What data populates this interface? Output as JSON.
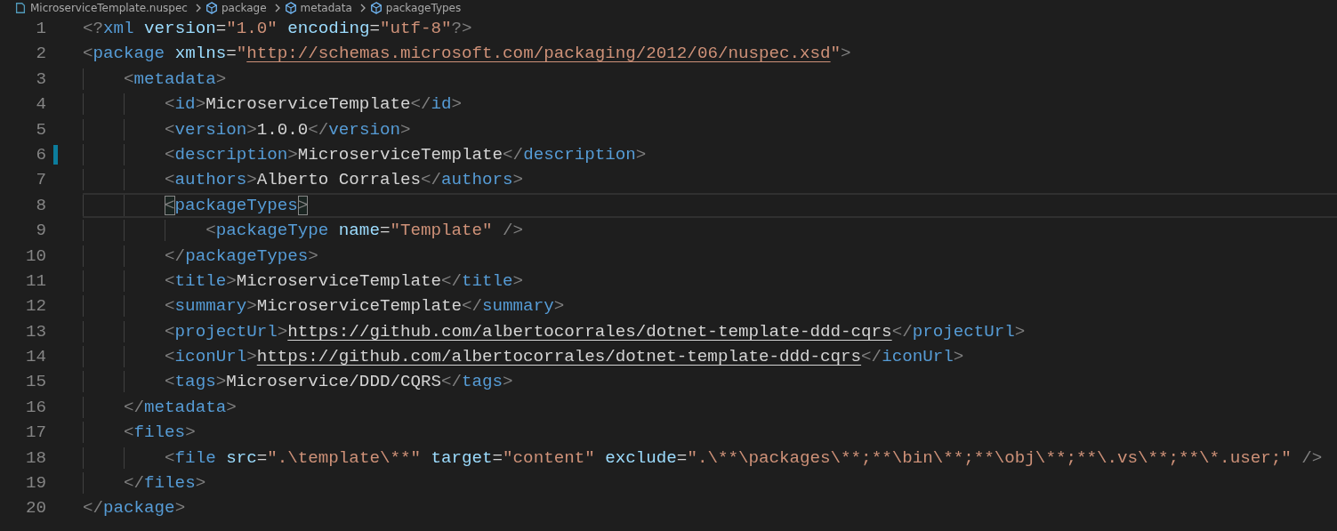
{
  "breadcrumb": [
    {
      "kind": "file",
      "label": "MicroserviceTemplate.nuspec"
    },
    {
      "kind": "symbol",
      "label": "package"
    },
    {
      "kind": "symbol",
      "label": "metadata"
    },
    {
      "kind": "symbol",
      "label": "packageTypes"
    }
  ],
  "lines": [
    {
      "number": "1",
      "modified": false,
      "selected": false,
      "tokens": [
        {
          "kind": "punct",
          "text": "<?"
        },
        {
          "kind": "tag",
          "text": "xml"
        },
        {
          "kind": "attr",
          "text": " version"
        },
        {
          "kind": "text",
          "text": "="
        },
        {
          "kind": "string",
          "text": "\"1.0\""
        },
        {
          "kind": "attr",
          "text": " encoding"
        },
        {
          "kind": "text",
          "text": "="
        },
        {
          "kind": "string",
          "text": "\"utf-8\""
        },
        {
          "kind": "punct",
          "text": "?>"
        }
      ]
    },
    {
      "number": "2",
      "modified": false,
      "selected": false,
      "tokens": [
        {
          "kind": "punct",
          "text": "<"
        },
        {
          "kind": "tag",
          "text": "package"
        },
        {
          "kind": "attr",
          "text": " xmlns"
        },
        {
          "kind": "text",
          "text": "="
        },
        {
          "kind": "string",
          "text": "\""
        },
        {
          "kind": "link",
          "text": "http://schemas.microsoft.com/packaging/2012/06/nuspec.xsd"
        },
        {
          "kind": "string",
          "text": "\""
        },
        {
          "kind": "punct",
          "text": ">"
        }
      ],
      "children": [
        {
          "number": "3",
          "modified": false,
          "selected": false,
          "tokens": [
            {
              "kind": "punct",
              "text": "<"
            },
            {
              "kind": "tag",
              "text": "metadata"
            },
            {
              "kind": "punct",
              "text": ">"
            }
          ],
          "children": [
            {
              "number": "4",
              "modified": false,
              "selected": false,
              "tokens": [
                {
                  "kind": "punct",
                  "text": "<"
                },
                {
                  "kind": "tag",
                  "text": "id"
                },
                {
                  "kind": "punct",
                  "text": ">"
                },
                {
                  "kind": "text",
                  "text": "MicroserviceTemplate"
                },
                {
                  "kind": "punct",
                  "text": "</"
                },
                {
                  "kind": "tag",
                  "text": "id"
                },
                {
                  "kind": "punct",
                  "text": ">"
                }
              ]
            },
            {
              "number": "5",
              "modified": false,
              "selected": false,
              "tokens": [
                {
                  "kind": "punct",
                  "text": "<"
                },
                {
                  "kind": "tag",
                  "text": "version"
                },
                {
                  "kind": "punct",
                  "text": ">"
                },
                {
                  "kind": "text",
                  "text": "1.0.0"
                },
                {
                  "kind": "punct",
                  "text": "</"
                },
                {
                  "kind": "tag",
                  "text": "version"
                },
                {
                  "kind": "punct",
                  "text": ">"
                }
              ]
            },
            {
              "number": "6",
              "modified": true,
              "selected": false,
              "tokens": [
                {
                  "kind": "punct",
                  "text": "<"
                },
                {
                  "kind": "tag",
                  "text": "description"
                },
                {
                  "kind": "punct",
                  "text": ">"
                },
                {
                  "kind": "text",
                  "text": "MicroserviceTemplate"
                },
                {
                  "kind": "punct",
                  "text": "</"
                },
                {
                  "kind": "tag",
                  "text": "description"
                },
                {
                  "kind": "punct",
                  "text": ">"
                }
              ]
            },
            {
              "number": "7",
              "modified": false,
              "selected": false,
              "tokens": [
                {
                  "kind": "punct",
                  "text": "<"
                },
                {
                  "kind": "tag",
                  "text": "authors"
                },
                {
                  "kind": "punct",
                  "text": ">"
                },
                {
                  "kind": "text",
                  "text": "Alberto Corrales"
                },
                {
                  "kind": "punct",
                  "text": "</"
                },
                {
                  "kind": "tag",
                  "text": "authors"
                },
                {
                  "kind": "punct",
                  "text": ">"
                }
              ]
            },
            {
              "number": "8",
              "modified": false,
              "selected": true,
              "tokens": [
                {
                  "kind": "punct",
                  "text": "<",
                  "matched": true
                },
                {
                  "kind": "tag",
                  "text": "packageTypes"
                },
                {
                  "kind": "punct",
                  "text": ">",
                  "matched": true
                }
              ],
              "children": [
                {
                  "number": "9",
                  "modified": false,
                  "selected": false,
                  "tokens": [
                    {
                      "kind": "punct",
                      "text": "<"
                    },
                    {
                      "kind": "tag",
                      "text": "packageType"
                    },
                    {
                      "kind": "attr",
                      "text": " name"
                    },
                    {
                      "kind": "text",
                      "text": "="
                    },
                    {
                      "kind": "string",
                      "text": "\"Template\""
                    },
                    {
                      "kind": "punct",
                      "text": " />"
                    }
                  ]
                }
              ]
            },
            {
              "number": "10",
              "modified": false,
              "selected": false,
              "tokens": [
                {
                  "kind": "punct",
                  "text": "</"
                },
                {
                  "kind": "tag",
                  "text": "packageTypes"
                },
                {
                  "kind": "punct",
                  "text": ">"
                }
              ]
            },
            {
              "number": "11",
              "modified": false,
              "selected": false,
              "tokens": [
                {
                  "kind": "punct",
                  "text": "<"
                },
                {
                  "kind": "tag",
                  "text": "title"
                },
                {
                  "kind": "punct",
                  "text": ">"
                },
                {
                  "kind": "text",
                  "text": "MicroserviceTemplate"
                },
                {
                  "kind": "punct",
                  "text": "</"
                },
                {
                  "kind": "tag",
                  "text": "title"
                },
                {
                  "kind": "punct",
                  "text": ">"
                }
              ]
            },
            {
              "number": "12",
              "modified": false,
              "selected": false,
              "tokens": [
                {
                  "kind": "punct",
                  "text": "<"
                },
                {
                  "kind": "tag",
                  "text": "summary"
                },
                {
                  "kind": "punct",
                  "text": ">"
                },
                {
                  "kind": "text",
                  "text": "MicroserviceTemplate"
                },
                {
                  "kind": "punct",
                  "text": "</"
                },
                {
                  "kind": "tag",
                  "text": "summary"
                },
                {
                  "kind": "punct",
                  "text": ">"
                }
              ]
            },
            {
              "number": "13",
              "modified": false,
              "selected": false,
              "tokens": [
                {
                  "kind": "punct",
                  "text": "<"
                },
                {
                  "kind": "tag",
                  "text": "projectUrl"
                },
                {
                  "kind": "punct",
                  "text": ">"
                },
                {
                  "kind": "textlink",
                  "text": "https://github.com/albertocorrales/dotnet-template-ddd-cqrs"
                },
                {
                  "kind": "punct",
                  "text": "</"
                },
                {
                  "kind": "tag",
                  "text": "projectUrl"
                },
                {
                  "kind": "punct",
                  "text": ">"
                }
              ]
            },
            {
              "number": "14",
              "modified": false,
              "selected": false,
              "tokens": [
                {
                  "kind": "punct",
                  "text": "<"
                },
                {
                  "kind": "tag",
                  "text": "iconUrl"
                },
                {
                  "kind": "punct",
                  "text": ">"
                },
                {
                  "kind": "textlink",
                  "text": "https://github.com/albertocorrales/dotnet-template-ddd-cqrs"
                },
                {
                  "kind": "punct",
                  "text": "</"
                },
                {
                  "kind": "tag",
                  "text": "iconUrl"
                },
                {
                  "kind": "punct",
                  "text": ">"
                }
              ]
            },
            {
              "number": "15",
              "modified": false,
              "selected": false,
              "tokens": [
                {
                  "kind": "punct",
                  "text": "<"
                },
                {
                  "kind": "tag",
                  "text": "tags"
                },
                {
                  "kind": "punct",
                  "text": ">"
                },
                {
                  "kind": "text",
                  "text": "Microservice/DDD/CQRS"
                },
                {
                  "kind": "punct",
                  "text": "</"
                },
                {
                  "kind": "tag",
                  "text": "tags"
                },
                {
                  "kind": "punct",
                  "text": ">"
                }
              ]
            }
          ]
        },
        {
          "number": "16",
          "modified": false,
          "selected": false,
          "tokens": [
            {
              "kind": "punct",
              "text": "</"
            },
            {
              "kind": "tag",
              "text": "metadata"
            },
            {
              "kind": "punct",
              "text": ">"
            }
          ]
        },
        {
          "number": "17",
          "modified": false,
          "selected": false,
          "tokens": [
            {
              "kind": "punct",
              "text": "<"
            },
            {
              "kind": "tag",
              "text": "files"
            },
            {
              "kind": "punct",
              "text": ">"
            }
          ],
          "children": [
            {
              "number": "18",
              "modified": false,
              "selected": false,
              "tokens": [
                {
                  "kind": "punct",
                  "text": "<"
                },
                {
                  "kind": "tag",
                  "text": "file"
                },
                {
                  "kind": "attr",
                  "text": " src"
                },
                {
                  "kind": "text",
                  "text": "="
                },
                {
                  "kind": "string",
                  "text": "\".\\template\\**\""
                },
                {
                  "kind": "attr",
                  "text": " target"
                },
                {
                  "kind": "text",
                  "text": "="
                },
                {
                  "kind": "string",
                  "text": "\"content\""
                },
                {
                  "kind": "attr",
                  "text": " exclude"
                },
                {
                  "kind": "text",
                  "text": "="
                },
                {
                  "kind": "string",
                  "text": "\".\\**\\packages\\**;**\\bin\\**;**\\obj\\**;**\\.vs\\**;**\\*.user;\""
                },
                {
                  "kind": "punct",
                  "text": " />"
                }
              ]
            }
          ]
        },
        {
          "number": "19",
          "modified": false,
          "selected": false,
          "tokens": [
            {
              "kind": "punct",
              "text": "</"
            },
            {
              "kind": "tag",
              "text": "files"
            },
            {
              "kind": "punct",
              "text": ">"
            }
          ]
        }
      ]
    },
    {
      "number": "20",
      "modified": false,
      "selected": false,
      "tokens": [
        {
          "kind": "punct",
          "text": "</"
        },
        {
          "kind": "tag",
          "text": "package"
        },
        {
          "kind": "punct",
          "text": ">"
        }
      ]
    }
  ]
}
